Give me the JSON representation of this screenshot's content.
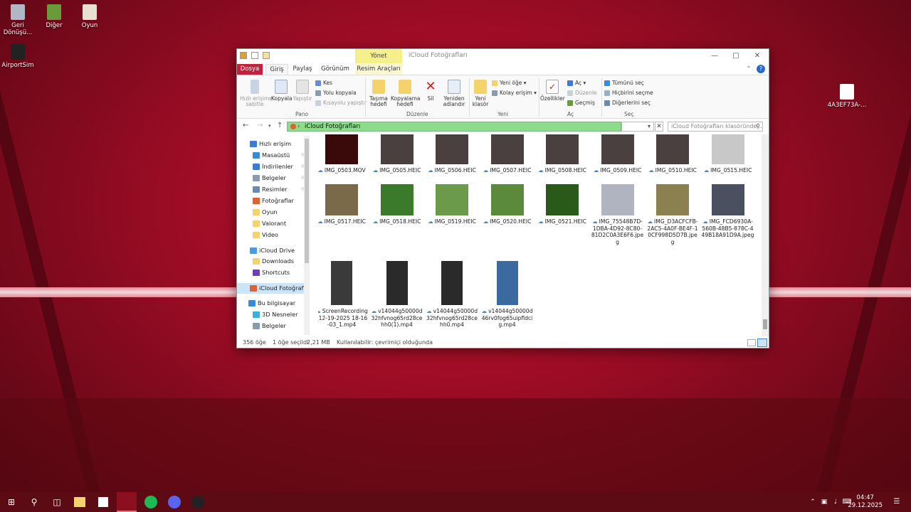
{
  "desktop": {
    "icons": [
      {
        "label": "Geri\nDönüşü...",
        "icon": "recycle-bin-icon",
        "color": "#b0b8c8"
      },
      {
        "label": "Diğer",
        "icon": "folder-app-icon",
        "color": "#6a9a3a"
      },
      {
        "label": "Oyun",
        "icon": "folder-app-icon",
        "color": "#e8e0d0"
      },
      {
        "label": "AirportSim",
        "icon": "airplane-icon",
        "color": "#222222"
      },
      {
        "label": "4A3EF73A-...",
        "icon": "file-icon",
        "color": "#ffffff"
      }
    ]
  },
  "window": {
    "title": "iCloud Fotoğrafları",
    "context_tab": "Yönet",
    "tabs": [
      "Dosya",
      "Giriş",
      "Paylaş",
      "Görünüm",
      "Resim Araçları"
    ],
    "ribbon": {
      "pin": "Hızlı erişime\nsabitle",
      "copy": "Kopyala",
      "paste": "Yapıştır",
      "cut": "Kes",
      "copy_path": "Yolu kopyala",
      "paste_shortcut": "Kısayolu yapıştır",
      "move_to": "Taşıma\nhedefi",
      "copy_to": "Kopyalama\nhedefi",
      "delete": "Sil",
      "rename": "Yeniden\nadlandır",
      "new_folder": "Yeni\nklasör",
      "new_item": "Yeni öğe",
      "easy_access": "Kolay erişim",
      "properties": "Özellikler",
      "open": "Aç",
      "edit": "Düzenle",
      "history": "Geçmiş",
      "select_all": "Tümünü seç",
      "select_none": "Hiçbirini seçme",
      "invert": "Diğerlerini seç",
      "groups": {
        "clipboard": "Pano",
        "organize": "Düzenle",
        "new": "Yeni",
        "open": "Aç",
        "select": "Seç"
      }
    },
    "address": {
      "path": "iCloud Fotoğrafları",
      "search_placeholder": "iCloud Fotoğrafları klasöründe..."
    },
    "nav": [
      {
        "label": "Hızlı erişim",
        "icon": "star-icon",
        "color": "#3a7ad8",
        "pin": false
      },
      {
        "label": "Masaüstü",
        "icon": "desktop-icon",
        "color": "#3a8ad8",
        "pin": true
      },
      {
        "label": "İndirilenler",
        "icon": "download-icon",
        "color": "#3a7ad8",
        "pin": true
      },
      {
        "label": "Belgeler",
        "icon": "documents-icon",
        "color": "#8a9ab0",
        "pin": true
      },
      {
        "label": "Resimler",
        "icon": "pictures-icon",
        "color": "#6a8ab0",
        "pin": true
      },
      {
        "label": "Fotoğraflar",
        "icon": "photos-icon",
        "color": "#e06030",
        "pin": false
      },
      {
        "label": "Oyun",
        "icon": "folder-icon",
        "color": "#f4d36a",
        "pin": false
      },
      {
        "label": "Valorant",
        "icon": "folder-icon",
        "color": "#f4d36a",
        "pin": false
      },
      {
        "label": "Video",
        "icon": "folder-icon",
        "color": "#f4d36a",
        "pin": false
      },
      {
        "label": "iCloud Drive",
        "icon": "cloud-icon",
        "color": "#4a9ae0",
        "pin": false
      },
      {
        "label": "Downloads",
        "icon": "folder-icon",
        "color": "#f4d36a",
        "pin": false
      },
      {
        "label": "Shortcuts",
        "icon": "shortcuts-icon",
        "color": "#6a40c0",
        "pin": false
      },
      {
        "label": "iCloud Fotoğrafları",
        "icon": "photos-icon",
        "color": "#e06030",
        "pin": false
      },
      {
        "label": "Bu bilgisayar",
        "icon": "computer-icon",
        "color": "#3a8ad8",
        "pin": false
      },
      {
        "label": "3D Nesneler",
        "icon": "cube-icon",
        "color": "#3ab0e0",
        "pin": false
      },
      {
        "label": "Belgeler",
        "icon": "documents-icon",
        "color": "#8a9ab0",
        "pin": false
      }
    ],
    "files": [
      {
        "name": "IMG_0503.MOV",
        "color": "#3a0a0a"
      },
      {
        "name": "IMG_0505.HEIC",
        "color": "#4a4040"
      },
      {
        "name": "IMG_0506.HEIC",
        "color": "#4a4040"
      },
      {
        "name": "IMG_0507.HEIC",
        "color": "#4a4040"
      },
      {
        "name": "IMG_0508.HEIC",
        "color": "#4a4040"
      },
      {
        "name": "IMG_0509.HEIC",
        "color": "#4a4040"
      },
      {
        "name": "IMG_0510.HEIC",
        "color": "#4a4040"
      },
      {
        "name": "IMG_0515.HEIC",
        "color": "#c8c8c8"
      },
      {
        "name": "IMG_0517.HEIC",
        "color": "#7a6a4a"
      },
      {
        "name": "IMG_0518.HEIC",
        "color": "#3a7a2a"
      },
      {
        "name": "IMG_0519.HEIC",
        "color": "#6a9a4a"
      },
      {
        "name": "IMG_0520.HEIC",
        "color": "#5a8a3a"
      },
      {
        "name": "IMG_0521.HEIC",
        "color": "#2a5a1a"
      },
      {
        "name": "IMG_75548B7D-1DBA-4D92-8C80-81D2C0A3E6F6.jpeg",
        "color": "#b0b4c0"
      },
      {
        "name": "IMG_D3ACFCFB-2AC5-4A0F-BE4F-10CF998D5D7B.jpeg",
        "color": "#8a8050"
      },
      {
        "name": "IMG_FCD6930A-560B-48B5-878C-449B18A91D9A.jpeg",
        "color": "#4a5060"
      },
      {
        "name": "ScreenRecording_12-19-2025 18-16-03_1.mp4",
        "color": "#3a3a3a"
      },
      {
        "name": "v14044g50000d32hfvnog65rd28cehh0(1).mp4",
        "color": "#2a2a2a"
      },
      {
        "name": "v14044g50000d32hfvnog65rd28cehh0.mp4",
        "color": "#2a2a2a"
      },
      {
        "name": "v14044g50000d46rv0fog65uipfldcig.mp4",
        "color": "#3a6aa0"
      }
    ],
    "status": {
      "count": "356 öğe",
      "selected": "1 öğe seçildi",
      "size": "2,21 MB",
      "availability": "Kullanılabilir: çevrimiçi olduğunda"
    }
  },
  "taskbar": {
    "time": "04:47",
    "date": "29.12.2025"
  }
}
